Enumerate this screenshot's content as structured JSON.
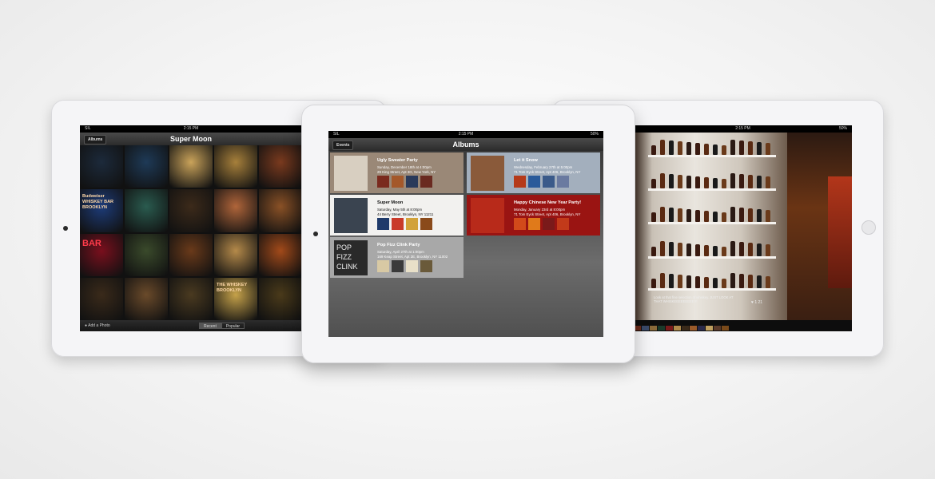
{
  "left_ipad": {
    "status": {
      "carrier": "SIL",
      "time": "2:15 PM"
    },
    "nav": {
      "back": "Albums",
      "title": "Super Moon"
    },
    "bottom": {
      "add_photo": "Add a Photo",
      "tabs": [
        "Recent",
        "Popular"
      ],
      "active_tab": "Recent"
    },
    "tile_colors": [
      "#1c2a3b",
      "#1e3a57",
      "#caa35a",
      "#a7803b",
      "#7a3a1e",
      "#1d3c7a",
      "#2a5b4f",
      "#3c2a1a",
      "#b0653a",
      "#8a5126",
      "#7a0f1d",
      "#3a4a2b",
      "#6a3a1a",
      "#b58a4a",
      "#a24a1a",
      "#3a2a1a",
      "#6a4a2a",
      "#4a3a20",
      "#c6a24a",
      "#4a3a1a"
    ],
    "sign_texts": [
      "Budweiser",
      "WHISKEY BAR",
      "BROOKLYN",
      "BAR",
      "THE WHISKEY",
      "BROOKLYN"
    ]
  },
  "center_ipad": {
    "status": {
      "carrier": "SIL",
      "time": "2:15 PM",
      "battery": "50%"
    },
    "nav": {
      "back": "Events",
      "title": "Albums"
    },
    "albums": [
      {
        "title": "Ugly Sweater Party",
        "line1": "Sunday, December 18th at 4:00pm",
        "line2": "29 King Street, Apt 3G, New York, NY",
        "bg": "#9a8877",
        "text": "#ffffff",
        "thumb": "#d8cfc1",
        "pics": [
          "#7a2a1e",
          "#a4582a",
          "#2a3a5a",
          "#6a2a20"
        ]
      },
      {
        "title": "Let it Snow",
        "line1": "Wednesday, February 27th at 5:00pm",
        "line2": "71 Tom Eyck Street, Apt 406, Brooklyn, NY",
        "bg": "#a3afbd",
        "text": "#ffffff",
        "thumb": "#8a5a3a",
        "pics": [
          "#b53a1a",
          "#2a5a9a",
          "#3a5a8a",
          "#6a7aa0"
        ]
      },
      {
        "title": "Super Moon",
        "line1": "Saturday, May 5th at 8:00pm",
        "line2": "44 Berry Street, Brooklyn, NY 11211",
        "bg": "#f2f1ef",
        "text": "#111111",
        "thumb": "#3a4450",
        "pics": [
          "#1f3a6a",
          "#c93a2a",
          "#d2a23a",
          "#8a4a1a"
        ]
      },
      {
        "title": "Happy Chinese New Year Party!",
        "line1": "Monday, January 23rd at 8:00pm",
        "line2": "71 Tom Eyck Street, Apt 406, Brooklyn, NY",
        "bg": "#9a1412",
        "text": "#ffffff",
        "thumb": "#b82a1a",
        "pics": [
          "#d24a1a",
          "#e07a1a",
          "#7a1a1a",
          "#c23a1a"
        ]
      },
      {
        "title": "Pop Fizz Clink Party",
        "line1": "Saturday, April 27th at 1:00pm",
        "line2": "169 Keap Street, Apt 2E, Brooklyn, NY 11002",
        "bg": "#a8a8a8",
        "text": "#ffffff",
        "thumb": "#2a2a2a",
        "pics": [
          "#d8c9a4",
          "#3a3a3a",
          "#e8e0c8",
          "#6a5a3a"
        ]
      }
    ],
    "thumb_texts": [
      "POP",
      "FIZZ",
      "CLINK"
    ]
  },
  "right_ipad": {
    "status": {
      "time": "2:15 PM",
      "battery": "50%"
    },
    "caption": "Look at that fine selection of whiskey. JUST LOOK AT THAT WHISKEEEEEEEEEY!",
    "likes": "1  21",
    "strip_colors": [
      "#6a2a1a",
      "#3a4a6a",
      "#8a6a3a",
      "#1a3a2a",
      "#7a1a1a",
      "#b08a4a",
      "#3a2a1a",
      "#9a5a2a",
      "#2a2a4a",
      "#c0a060",
      "#5a3a2a",
      "#7a4a1a"
    ]
  }
}
